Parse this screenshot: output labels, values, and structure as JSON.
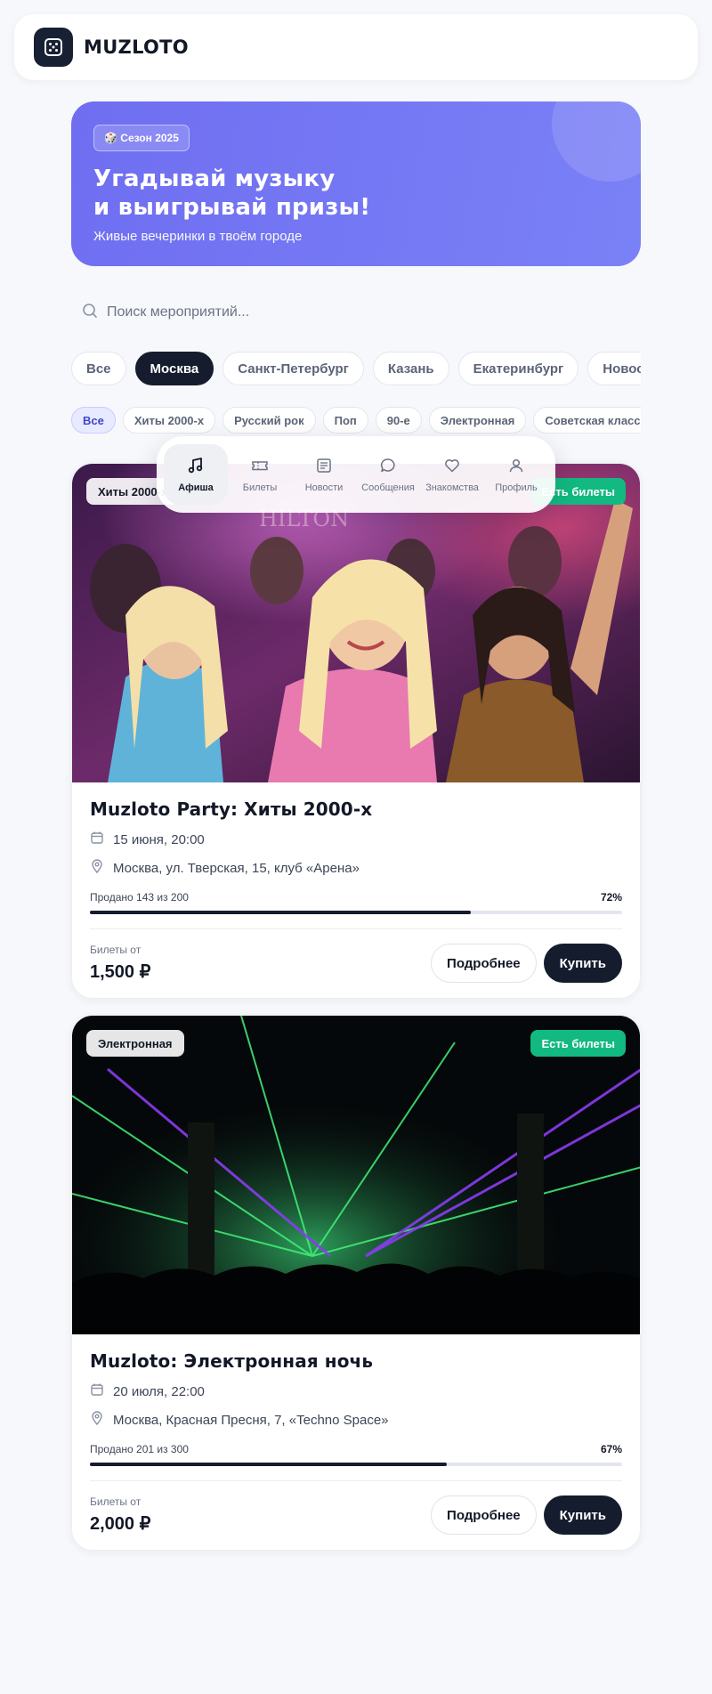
{
  "header": {
    "logo_text": "MUZLOTO",
    "logo_icon": "dice-icon"
  },
  "hero": {
    "badge": "🎲 Сезон 2025",
    "title": "Угадывай музыку\nи выигрывай призы!",
    "subtitle": "Живые вечеринки в твоём городе"
  },
  "search": {
    "placeholder": "Поиск мероприятий...",
    "value": ""
  },
  "cities": [
    "Все",
    "Москва",
    "Санкт-Петербург",
    "Казань",
    "Екатеринбург",
    "Новосибирск"
  ],
  "cities_active": "Москва",
  "genres": [
    "Все",
    "Хиты 2000-х",
    "Русский рок",
    "Поп",
    "90-е",
    "Электронная",
    "Советская классика"
  ],
  "genres_active": "Все",
  "nav": {
    "items": [
      {
        "label": "Афиша",
        "icon": "music-note-icon",
        "active": true
      },
      {
        "label": "Билеты",
        "icon": "ticket-icon",
        "active": false
      },
      {
        "label": "Новости",
        "icon": "newspaper-icon",
        "active": false
      },
      {
        "label": "Сообщения",
        "icon": "chat-bubble-icon",
        "active": false
      },
      {
        "label": "Знакомства",
        "icon": "heart-icon",
        "active": false
      },
      {
        "label": "Профиль",
        "icon": "user-icon",
        "active": false
      }
    ]
  },
  "events": [
    {
      "genre": "Хиты 2000-х",
      "availability": "Есть билеты",
      "title": "Muzloto Party: Хиты 2000-х",
      "date": "15 июня, 20:00",
      "place": "Москва, ул. Тверская, 15, клуб «Арена»",
      "sold_text": "Продано 143 из 200",
      "sold_percent": "72%",
      "sold_fraction": 0.715,
      "price_label": "Билеты от",
      "price": "1,500 ₽",
      "more_label": "Подробнее",
      "buy_label": "Купить",
      "image": "party-crowd-photo"
    },
    {
      "genre": "Электронная",
      "availability": "Есть билеты",
      "title": "Muzloto: Электронная ночь",
      "date": "20 июля, 22:00",
      "place": "Москва, Красная Пресня, 7, «Techno Space»",
      "sold_text": "Продано 201 из 300",
      "sold_percent": "67%",
      "sold_fraction": 0.67,
      "price_label": "Билеты от",
      "price": "2,000 ₽",
      "more_label": "Подробнее",
      "buy_label": "Купить",
      "image": "laser-club-photo"
    }
  ],
  "colors": {
    "accent": "#6f6ef1",
    "dark": "#151c2e",
    "success": "#12b981"
  }
}
